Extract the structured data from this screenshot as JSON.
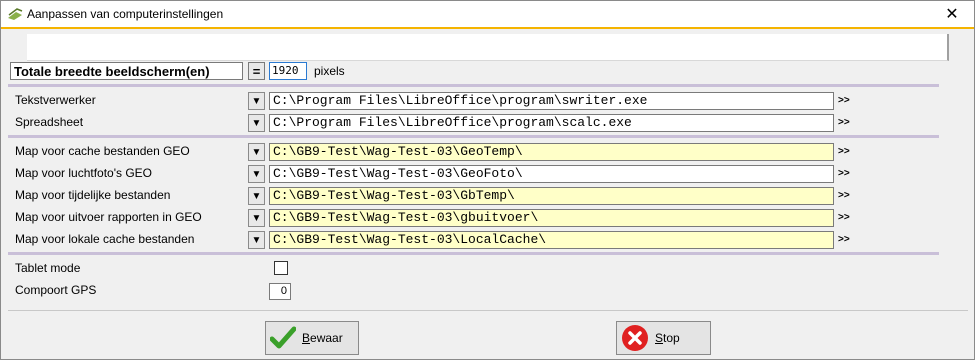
{
  "window": {
    "title": "Aanpassen van computerinstellingen",
    "close_glyph": "✕"
  },
  "screen_width": {
    "label": "Totale breedte beeldscherm(en)",
    "equals": "=",
    "value": "1920",
    "unit": "pixels"
  },
  "programs": [
    {
      "label": "Tekstverwerker",
      "path": "C:\\Program Files\\LibreOffice\\program\\swriter.exe",
      "more": ">>"
    },
    {
      "label": "Spreadsheet",
      "path": "C:\\Program Files\\LibreOffice\\program\\scalc.exe",
      "more": ">>"
    }
  ],
  "folders": [
    {
      "label": "Map voor cache bestanden GEO",
      "path": "C:\\GB9-Test\\Wag-Test-03\\GeoTemp\\",
      "more": ">>"
    },
    {
      "label": "Map voor luchtfoto's GEO",
      "path": "C:\\GB9-Test\\Wag-Test-03\\GeoFoto\\",
      "more": ">>"
    },
    {
      "label": "Map voor tijdelijke bestanden",
      "path": "C:\\GB9-Test\\Wag-Test-03\\GbTemp\\",
      "more": ">>"
    },
    {
      "label": "Map voor uitvoer rapporten in GEO",
      "path": "C:\\GB9-Test\\Wag-Test-03\\gbuitvoer\\",
      "more": ">>"
    },
    {
      "label": "Map voor lokale cache bestanden",
      "path": "C:\\GB9-Test\\Wag-Test-03\\LocalCache\\",
      "more": ">>"
    }
  ],
  "options": {
    "tablet_mode_label": "Tablet mode",
    "tablet_mode_checked": false,
    "gps_port_label": "Compoort GPS",
    "gps_port_value": "0"
  },
  "buttons": {
    "save_first": "B",
    "save_rest": "ewaar",
    "stop_first": "S",
    "stop_rest": "top"
  },
  "colors": {
    "accent_line": "#f5b400",
    "path_highlight": "#ffffc8",
    "separator": "#c9bfd8",
    "check_green": "#3aa02a",
    "stop_red": "#e02020"
  }
}
